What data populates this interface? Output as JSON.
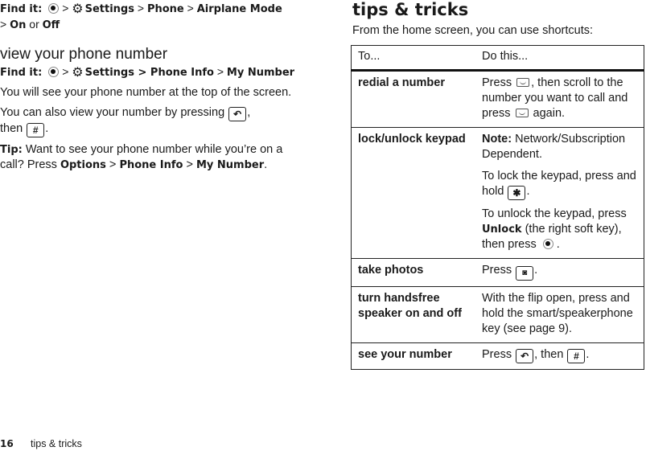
{
  "left": {
    "airplane": {
      "find_label": "Find it:",
      "sep": ">",
      "settings": "Settings",
      "phone": "Phone",
      "airplane_mode": "Airplane Mode",
      "on": "On",
      "or": "or",
      "off": "Off"
    },
    "section_title": "view your phone number",
    "view_number": {
      "find_label": "Find it:",
      "sep": ">",
      "settings_path": "Settings > Phone Info",
      "my_number": "My Number"
    },
    "para1": "You will see your phone number at the top of the screen.",
    "para2_a": "You can also view your number by pressing",
    "para2_b": ",",
    "para2_c": "then",
    "para2_d": ".",
    "tip_label": "Tip:",
    "tip_text": "Want to see your phone number while you’re on a call? Press",
    "tip_options": "Options",
    "tip_phone_info": "Phone Info",
    "tip_my_number": "My Number",
    "tip_end": "."
  },
  "icons": {
    "center_key": "center-select-key",
    "settings": "settings-icon",
    "back_key": "↶",
    "hash_key": "#",
    "star_key": "✱",
    "camera_key": "📷"
  },
  "right": {
    "title": "tips & tricks",
    "intro": "From the home screen, you can use shortcuts:",
    "table": {
      "headers": [
        "To...",
        "Do this..."
      ],
      "rows": [
        {
          "to": "redial a number",
          "do_a": "Press",
          "do_b": ", then scroll to the number you want to call and press",
          "do_c": "again."
        },
        {
          "to": "lock/unlock keypad",
          "note_label": "Note:",
          "note_text": "Network/Subscription Dependent.",
          "lock_text": "To lock the keypad, press and hold",
          "lock_end": ".",
          "unlock_a": "To unlock the keypad, press",
          "unlock_bold": "Unlock",
          "unlock_b": "(the right soft key), then press",
          "unlock_end": "."
        },
        {
          "to": "take photos",
          "do_a": "Press",
          "do_end": "."
        },
        {
          "to": "turn handsfree speaker on and off",
          "do_text": "With the flip open, press and hold the smart/speakerphone key (see page 9)."
        },
        {
          "to": "see your number",
          "do_a": "Press",
          "do_b": ", then",
          "do_end": "."
        }
      ]
    }
  },
  "footer": {
    "page_number": "16",
    "section": "tips & tricks"
  }
}
